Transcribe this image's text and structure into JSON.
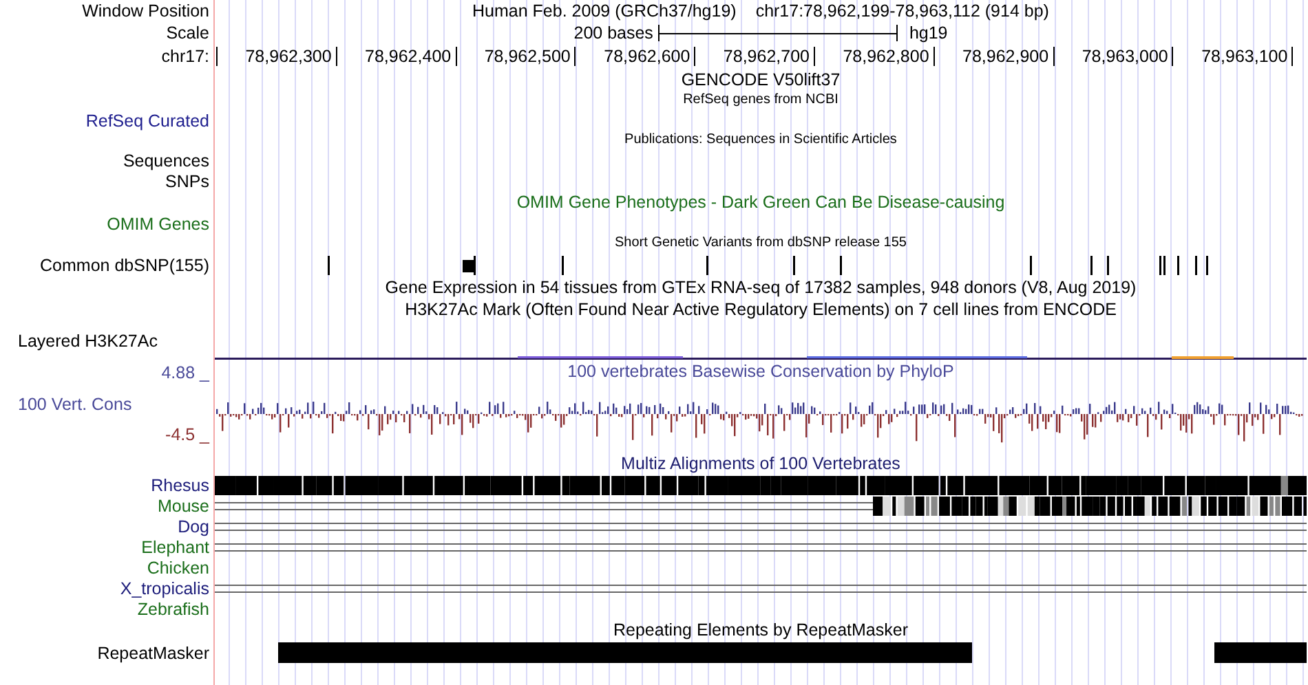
{
  "header": {
    "label": "Window Position",
    "assembly": "Human Feb. 2009 (GRCh37/hg19)",
    "position": "chr17:78,962,199-78,963,112 (914 bp)"
  },
  "scale": {
    "label": "Scale",
    "span": "200 bases",
    "assembly": "hg19"
  },
  "ruler": {
    "label": "chr17:",
    "ticks": [
      "78,962,300",
      "78,962,400",
      "78,962,500",
      "78,962,600",
      "78,962,700",
      "78,962,800",
      "78,962,900",
      "78,963,000",
      "78,963,100"
    ]
  },
  "tracks": [
    {
      "kind": "title",
      "title": "GENCODE V50lift37"
    },
    {
      "kind": "subtitle",
      "title": "RefSeq genes from NCBI"
    },
    {
      "kind": "label",
      "label": "RefSeq Curated",
      "color": "#20208f"
    },
    {
      "kind": "subtitle",
      "title": "Publications: Sequences in Scientific Articles"
    },
    {
      "kind": "label",
      "label": "Sequences"
    },
    {
      "kind": "label",
      "label": "SNPs"
    },
    {
      "kind": "title",
      "title": "OMIM Gene Phenotypes - Dark Green Can Be Disease-causing",
      "color": "#1a6e1a"
    },
    {
      "kind": "label",
      "label": "OMIM Genes",
      "color": "#1a6e1a"
    },
    {
      "kind": "subtitle",
      "title": "Short Genetic Variants from dbSNP release 155"
    },
    {
      "kind": "snps",
      "label": "Common dbSNP(155)"
    },
    {
      "kind": "title",
      "title": "Gene Expression in 54 tissues from GTEx RNA-seq of 17382 samples, 948 donors (V8, Aug 2019)"
    },
    {
      "kind": "title",
      "title": "H3K27Ac Mark (Often Found Near Active Regulatory Elements) on 7 cell lines from ENCODE"
    },
    {
      "kind": "signal",
      "label": "Layered H3K27Ac"
    },
    {
      "kind": "conservation",
      "title": "100 vertebrates Basewise Conservation by PhyloP",
      "label": "100 Vert. Cons",
      "max": "4.88 _",
      "min": "-4.5 _",
      "color": "#4a4a99"
    },
    {
      "kind": "title",
      "title": "Multiz Alignments of 100 Vertebrates",
      "color": "#1c1c6e"
    },
    {
      "kind": "align_full",
      "label": "Rhesus",
      "color": "#1c1c7a"
    },
    {
      "kind": "align_partial",
      "label": "Mouse",
      "color": "#1a6e1a"
    },
    {
      "kind": "align_lines",
      "label": "Dog",
      "color": "#1c1c7a"
    },
    {
      "kind": "align_lines",
      "label": "Elephant",
      "color": "#1a6e1a"
    },
    {
      "kind": "align_none",
      "label": "Chicken",
      "color": "#1a6e1a"
    },
    {
      "kind": "align_lines",
      "label": "X_tropicalis",
      "color": "#1c1c7a"
    },
    {
      "kind": "align_none",
      "label": "Zebrafish",
      "color": "#1a6e1a"
    },
    {
      "kind": "title",
      "title": "Repeating Elements by RepeatMasker"
    },
    {
      "kind": "repeats",
      "label": "RepeatMasker"
    }
  ]
}
